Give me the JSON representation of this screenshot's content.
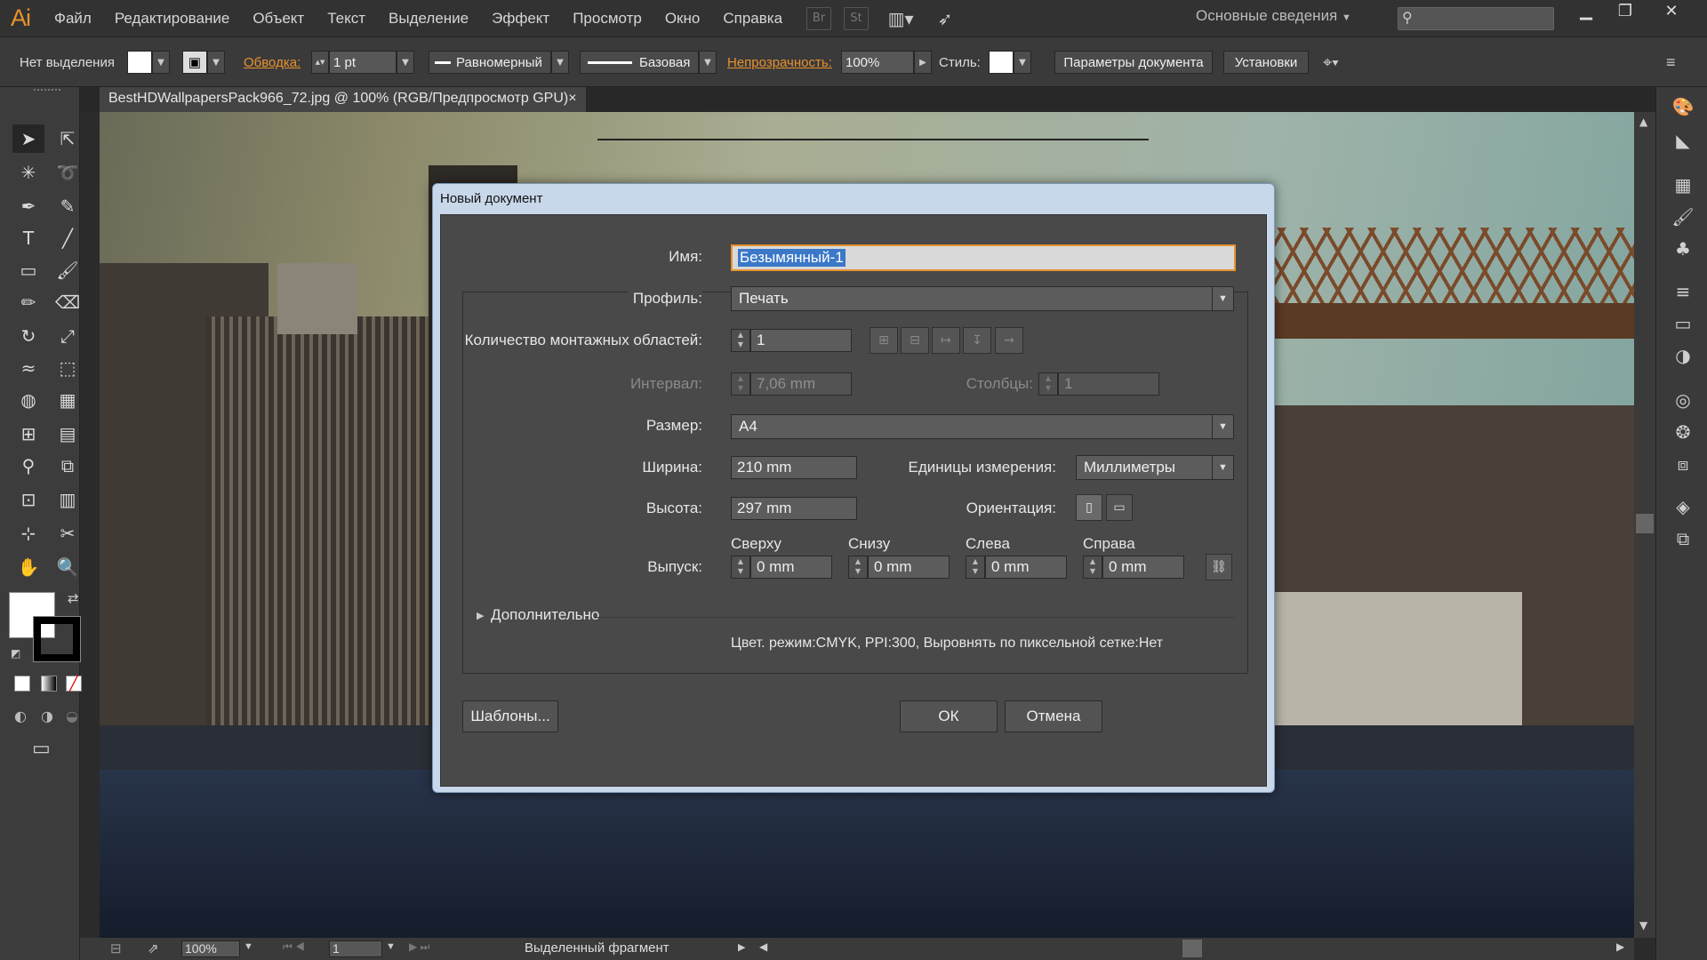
{
  "app": {
    "logo": "Ai"
  },
  "menu": [
    "Файл",
    "Редактирование",
    "Объект",
    "Текст",
    "Выделение",
    "Эффект",
    "Просмотр",
    "Окно",
    "Справка"
  ],
  "menu_buttons": [
    "Br",
    "St"
  ],
  "workspace_label": "Основные сведения",
  "control_bar": {
    "no_selection": "Нет выделения",
    "stroke_label": "Обводка:",
    "stroke_value": "1 pt",
    "profile_value": "Равномерный",
    "brush_value": "Базовая",
    "opacity_label": "Непрозрачность:",
    "opacity_value": "100%",
    "style_label": "Стиль:",
    "doc_settings_button": "Параметры документа",
    "preferences_button": "Установки"
  },
  "document_tab": {
    "title": "BestHDWallpapersPack966_72.jpg @ 100% (RGB/Предпросмотр GPU)",
    "close": "×"
  },
  "status_bar": {
    "zoom": "100%",
    "artboard": "1",
    "status_text": "Выделенный фрагмент"
  },
  "dialog": {
    "title": "Новый документ",
    "name_label": "Имя:",
    "name_value": "Безымянный-1",
    "profile_label": "Профиль:",
    "profile_value": "Печать",
    "artboards_label": "Количество монтажных областей:",
    "artboards_value": "1",
    "spacing_label": "Интервал:",
    "spacing_value": "7,06 mm",
    "columns_label": "Столбцы:",
    "columns_value": "1",
    "size_label": "Размер:",
    "size_value": "A4",
    "width_label": "Ширина:",
    "width_value": "210 mm",
    "units_label": "Единицы измерения:",
    "units_value": "Миллиметры",
    "height_label": "Высота:",
    "height_value": "297 mm",
    "orientation_label": "Ориентация:",
    "bleed_label": "Выпуск:",
    "bleed_top_label": "Сверху",
    "bleed_bottom_label": "Снизу",
    "bleed_left_label": "Слева",
    "bleed_right_label": "Справа",
    "bleed_top": "0 mm",
    "bleed_bottom": "0 mm",
    "bleed_left": "0 mm",
    "bleed_right": "0 mm",
    "advanced_label": "Дополнительно",
    "summary": "Цвет. режим:CMYK, PPI:300, Выровнять по пиксельной сетке:Нет",
    "templates_button": "Шаблоны...",
    "ok_button": "ОК",
    "cancel_button": "Отмена"
  },
  "colors": {
    "accent": "#e8922e",
    "name_highlight": "#3b78c8",
    "dialog_frame": "#c8d8ea"
  }
}
